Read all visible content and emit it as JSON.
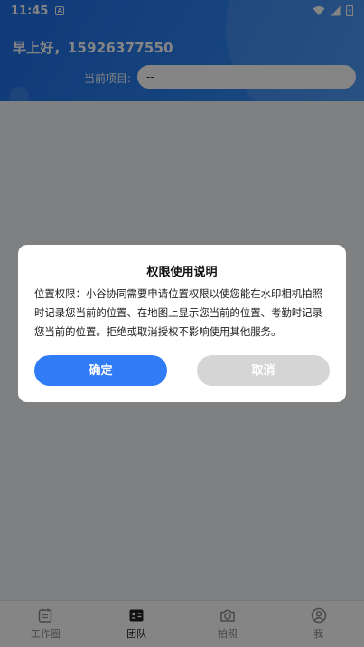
{
  "status_bar": {
    "time": "11:45",
    "notification_icon": "a-icon",
    "icons": [
      "wifi-icon",
      "signal-icon",
      "battery-icon"
    ]
  },
  "header": {
    "greeting": "早上好，15926377550",
    "project_label": "当前项目:",
    "project_value": "--"
  },
  "dialog": {
    "title": "权限使用说明",
    "body": "位置权限：小谷协同需要申请位置权限以使您能在水印相机拍照时记录您当前的位置、在地图上显示您当前的位置、考勤时记录您当前的位置。拒绝或取消授权不影响使用其他服务。",
    "confirm_label": "确定",
    "cancel_label": "取消"
  },
  "bottom_nav": {
    "items": [
      {
        "label": "工作圈",
        "icon": "calendar-icon"
      },
      {
        "label": "团队",
        "icon": "id-card-icon"
      },
      {
        "label": "拍照",
        "icon": "camera-icon"
      },
      {
        "label": "我",
        "icon": "user-icon"
      }
    ],
    "active_index": 1
  },
  "colors": {
    "header_blue": "#2c82f0",
    "confirm_blue": "#2f7cf6",
    "cancel_gray": "#d5d5d5"
  }
}
